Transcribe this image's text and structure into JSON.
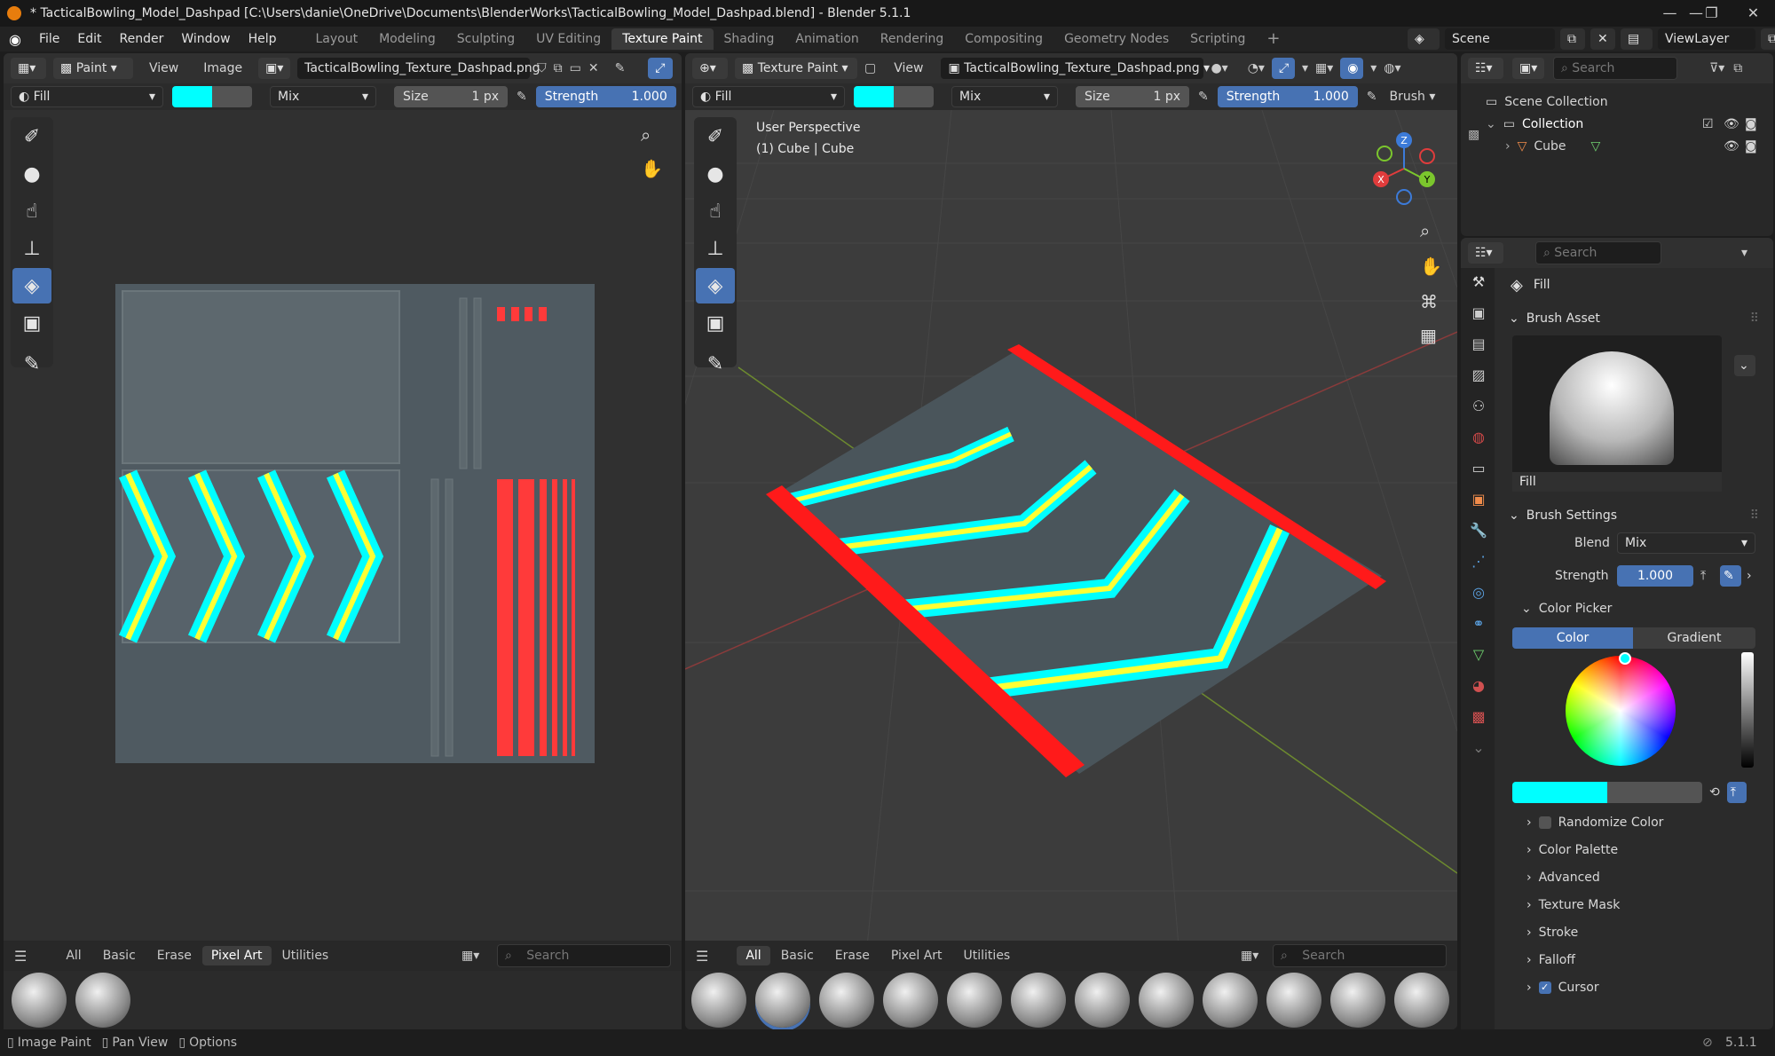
{
  "window": {
    "title": "* TacticalBowling_Model_Dashpad [C:\\Users\\danie\\OneDrive\\Documents\\BlenderWorks\\TacticalBowling_Model_Dashpad.blend] - Blender 5.1.1",
    "min": "—",
    "max": "❐",
    "close": "✕"
  },
  "menu": [
    "File",
    "Edit",
    "Render",
    "Window",
    "Help"
  ],
  "workspaces": [
    "Layout",
    "Modeling",
    "Sculpting",
    "UV Editing",
    "Texture Paint",
    "Shading",
    "Animation",
    "Rendering",
    "Compositing",
    "Geometry Nodes",
    "Scripting"
  ],
  "workspace_add": "+",
  "scene": {
    "name": "Scene",
    "view_layer": "ViewLayer"
  },
  "image_editor": {
    "mode": "Paint",
    "view": "View",
    "image_menu": "Image",
    "image_name": "TacticalBowling_Texture_Dashpad.png",
    "brush": "Fill",
    "blend": "Mix",
    "size_label": "Size",
    "size_value": "1 px",
    "strength_label": "Strength",
    "strength_value": "1.000",
    "shelf_tabs": [
      "All",
      "Basic",
      "Erase",
      "Pixel Art",
      "Utilities"
    ],
    "shelf_active": "Pixel Art",
    "search_placeholder": "Search"
  },
  "viewport": {
    "mode": "Texture Paint",
    "view": "View",
    "image_name": "TacticalBowling_Texture_Dashpad.png",
    "brush": "Fill",
    "blend": "Mix",
    "size_label": "Size",
    "size_value": "1 px",
    "strength_label": "Strength",
    "strength_value": "1.000",
    "brush_menu": "Brush",
    "perspective": "User Perspective",
    "object_info": "(1) Cube | Cube",
    "gizmo": {
      "x": "X",
      "y": "Y",
      "z": "Z"
    },
    "shelf_tabs": [
      "All",
      "Basic",
      "Erase",
      "Pixel Art",
      "Utilities"
    ],
    "shelf_active": "All",
    "search_placeholder": "Search"
  },
  "outliner": {
    "search_placeholder": "Search",
    "scene_collection": "Scene Collection",
    "collection": "Collection",
    "object": "Cube"
  },
  "properties": {
    "search_placeholder": "Search",
    "tool_name": "Fill",
    "brush_asset_label": "Brush Asset",
    "asset_name": "Fill",
    "brush_settings_label": "Brush Settings",
    "blend_label": "Blend",
    "blend_value": "Mix",
    "strength_label": "Strength",
    "strength_value": "1.000",
    "color_picker_label": "Color Picker",
    "color_tab": "Color",
    "gradient_tab": "Gradient",
    "randomize_color": "Randomize Color",
    "sections": [
      "Color Palette",
      "Advanced",
      "Texture Mask",
      "Stroke",
      "Falloff"
    ],
    "cursor": "Cursor"
  },
  "status_bar": {
    "items": [
      "Image Paint",
      "Pan View",
      "Options"
    ],
    "version": "5.1.1"
  },
  "colors": {
    "paint_color": "#00ffff",
    "accent": "#4772b3",
    "texture_red": "#ff3a3a",
    "texture_yellow": "#ffff33",
    "texture_bg": "#4f5a61"
  }
}
